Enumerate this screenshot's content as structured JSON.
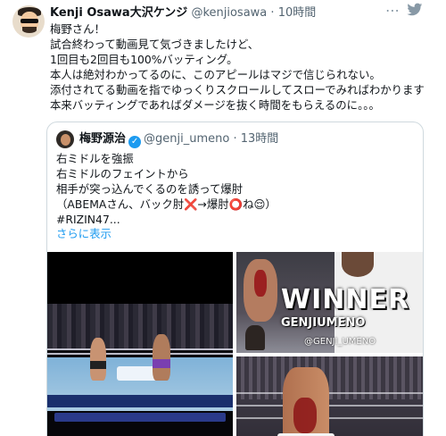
{
  "tweet": {
    "author_name": "Kenji Osawa大沢ケンジ",
    "author_handle": "@kenjiosawa",
    "separator": "·",
    "time": "10時間",
    "more_icon": "more-horizontal-icon",
    "bird_icon": "twitter-bird-icon",
    "text": "梅野さん！\n試合終わって動画見て気づきましたけど、\n1回目も2回目も100%バッティング。\n本人は絶対わかってるのに、このアピールはマジで信じられない。\n添付されてる動画を指でゆっくりスクロールしてスローでみればわかります\n本来バッティングであればダメージを抜く時間をもらえるのに。。。"
  },
  "quote": {
    "author_name": "梅野源治",
    "verified_icon": "verified-badge-icon",
    "author_handle": "@genji_umeno",
    "separator": "·",
    "time": "13時間",
    "text": "右ミドルを強振\n右ミドルのフェイントから\n相手が突っ込んでくるのを誘って爆肘\n（ABEMAさん、バック肘❌→爆肘⭕ね😌）\n#RIZIN47...",
    "show_more": "さらに表示",
    "media": {
      "winner_text": "WINNER",
      "winner_name": "GENJIUMENO",
      "photo_handle": "@GENJI_UMENO"
    }
  },
  "colors": {
    "link": "#1d9bf0",
    "secondary_text": "#536471",
    "border": "#cfd9de"
  }
}
